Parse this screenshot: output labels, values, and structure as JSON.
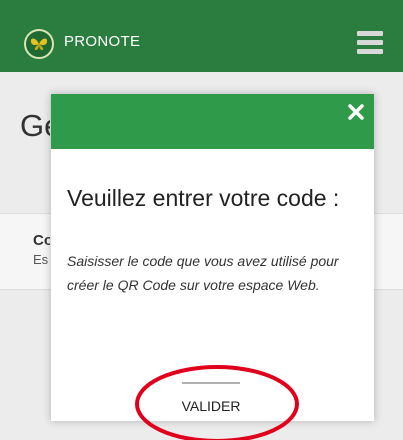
{
  "app": {
    "title": "PRONOTE"
  },
  "background": {
    "heading": "Gé",
    "card_title": "Co",
    "card_subtitle": "Es"
  },
  "modal": {
    "title": "Veuillez entrer votre code :",
    "description": "Saisisser le code que vous avez utilisé pour créer le QR Code sur votre espace Web.",
    "code_value": "",
    "validate_label": "VALIDER"
  },
  "colors": {
    "appbar": "#2a7d3f",
    "modal_header": "#2e9a4a",
    "annotation": "#e0001b"
  },
  "icons": {
    "logo": "butterfly-logo-icon",
    "menu": "hamburger-menu-icon",
    "close": "close-icon"
  }
}
